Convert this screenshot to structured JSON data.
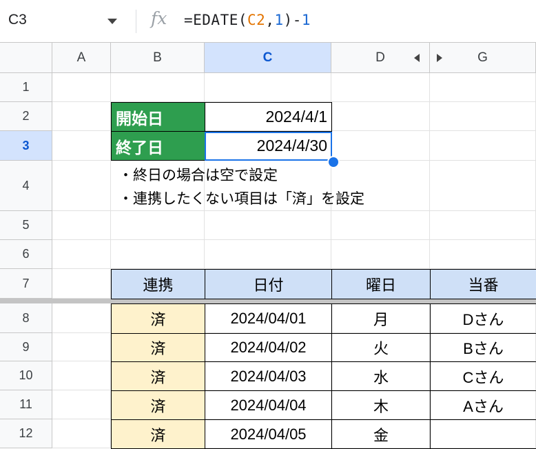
{
  "formula_bar": {
    "name_box": "C3",
    "fx": "fx",
    "formula_parts": [
      {
        "text": "=EDATE(",
        "color": "#202124"
      },
      {
        "text": "C2",
        "color": "#e37400"
      },
      {
        "text": ",",
        "color": "#202124"
      },
      {
        "text": "1",
        "color": "#1967d2"
      },
      {
        "text": ")-",
        "color": "#202124"
      },
      {
        "text": "1",
        "color": "#1967d2"
      }
    ]
  },
  "columns": [
    "A",
    "B",
    "C",
    "D",
    "G"
  ],
  "rows": [
    "1",
    "2",
    "3",
    "4",
    "5",
    "6",
    "7",
    "8",
    "9",
    "10",
    "11",
    "12"
  ],
  "settings": {
    "start_label": "開始日",
    "start_value": "2024/4/1",
    "end_label": "終了日",
    "end_value": "2024/4/30"
  },
  "notes": [
    "・終日の場合は空で設定",
    "・連携したくない項目は「済」を設定"
  ],
  "table": {
    "headers": [
      "連携",
      "日付",
      "曜日",
      "当番"
    ],
    "rows": [
      [
        "済",
        "2024/04/01",
        "月",
        "Dさん"
      ],
      [
        "済",
        "2024/04/02",
        "火",
        "Bさん"
      ],
      [
        "済",
        "2024/04/03",
        "水",
        "Cさん"
      ],
      [
        "済",
        "2024/04/04",
        "木",
        "Aさん"
      ],
      [
        "済",
        "2024/04/05",
        "金",
        ""
      ]
    ]
  },
  "colors": {
    "label_green": "#2e9e4f",
    "header_blue": "#cfe0f7",
    "done_yellow": "#fef2cc",
    "selection_blue": "#1a73e8"
  }
}
